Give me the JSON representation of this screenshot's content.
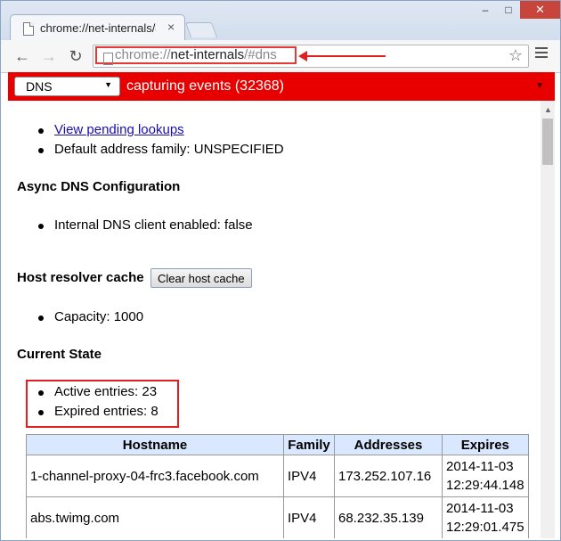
{
  "tab": {
    "title": "chrome://net-internals/#dns",
    "close": "×"
  },
  "window_controls": {
    "minimize": "–",
    "maximize": "□",
    "close": "✕"
  },
  "toolbar": {
    "back": "←",
    "forward": "→",
    "reload": "↻",
    "url_scheme": "chrome://",
    "url_host": "net-internals",
    "url_path": "/#dns",
    "star": "☆"
  },
  "net_bar": {
    "selected_view": "DNS",
    "status": "capturing events (32368)",
    "bg_color": "#e80000"
  },
  "dns": {
    "pending_link": "View pending lookups",
    "default_family": "Default address family: UNSPECIFIED",
    "async_heading": "Async DNS Configuration",
    "internal_client": "Internal DNS client enabled: false",
    "cache_heading": "Host resolver cache",
    "clear_button": "Clear host cache",
    "capacity": "Capacity: 1000",
    "state_heading": "Current State",
    "active_entries": "Active entries: 23",
    "expired_entries": "Expired entries: 8"
  },
  "table": {
    "headers": [
      "Hostname",
      "Family",
      "Addresses",
      "Expires"
    ],
    "rows": [
      {
        "hostname": "1-channel-proxy-04-frc3.facebook.com",
        "family": "IPV4",
        "addresses": "173.252.107.16",
        "expires_date": "2014-11-03",
        "expires_time": "12:29:44.148"
      },
      {
        "hostname": "abs.twimg.com",
        "family": "IPV4",
        "addresses": "68.232.35.139",
        "expires_date": "2014-11-03",
        "expires_time": "12:29:01.475"
      }
    ]
  },
  "annotation_color": "#e02020"
}
